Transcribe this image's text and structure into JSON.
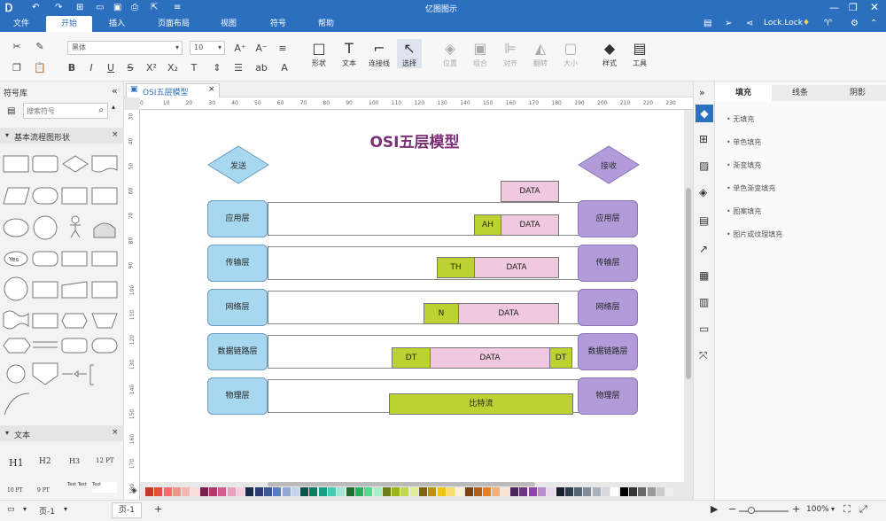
{
  "app": {
    "title": "亿图图示"
  },
  "menu": [
    "文件",
    "开始",
    "插入",
    "页面布局",
    "视图",
    "符号",
    "帮助"
  ],
  "user": "Lock.Lock",
  "ribbon": {
    "font": "黑体",
    "size": "10",
    "tools": [
      "形状",
      "文本",
      "连接线",
      "选择",
      "位置",
      "组合",
      "对齐",
      "翻转",
      "大小",
      "样式",
      "工具"
    ]
  },
  "left": {
    "title": "符号库",
    "search_placeholder": "搜索符号",
    "section1": "基本流程图形状",
    "section2": "文本",
    "text_samples": [
      "H1",
      "H2",
      "H3",
      "12 PT",
      "10 PT",
      "9 PT",
      "Text Text",
      "Text"
    ]
  },
  "tab": {
    "name": "OSI五层模型"
  },
  "ruler_h": [
    "0",
    "10",
    "20",
    "30",
    "40",
    "50",
    "60",
    "70",
    "80",
    "90",
    "100",
    "110",
    "120",
    "130",
    "140",
    "150",
    "160",
    "170",
    "180",
    "190",
    "200",
    "210",
    "220",
    "230"
  ],
  "ruler_v": [
    "30",
    "40",
    "50",
    "60",
    "70",
    "80",
    "90",
    "100",
    "110",
    "120",
    "130",
    "140",
    "150",
    "160",
    "170",
    "180"
  ],
  "diagram": {
    "title": "OSI五层模型",
    "send": "发送",
    "recv": "接收",
    "top_data": "DATA",
    "layers": [
      "应用层",
      "传输层",
      "网络层",
      "数据链路层",
      "物理层"
    ],
    "row1": [
      "AH",
      "DATA"
    ],
    "row2": [
      "TH",
      "DATA"
    ],
    "row3": [
      "N",
      "DATA"
    ],
    "row4": [
      "DT",
      "DATA",
      "DT"
    ],
    "row5": "比特流"
  },
  "right": {
    "tabs": [
      "填充",
      "线条",
      "阴影"
    ],
    "options": [
      "无填充",
      "单色填充",
      "渐变填充",
      "单色渐变填充",
      "图案填充",
      "图片或纹理填充"
    ]
  },
  "status": {
    "page1": "页-1",
    "page_tab": "页-1",
    "zoom": "100%"
  }
}
